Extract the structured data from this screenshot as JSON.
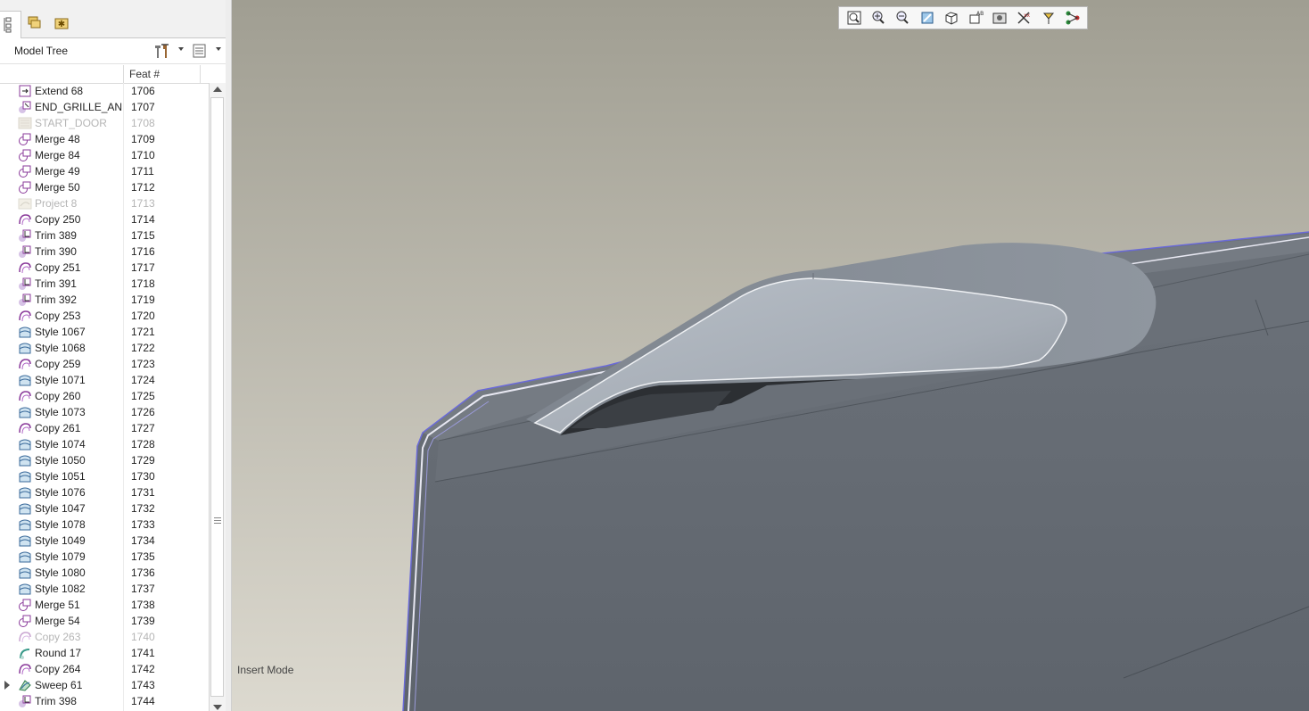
{
  "panel_tabs": [
    {
      "name": "model-tree-tab",
      "icon": "tree-icon",
      "active": true
    },
    {
      "name": "folder-browser-tab",
      "icon": "folders-icon",
      "active": false
    },
    {
      "name": "favorites-tab",
      "icon": "favorites-icon",
      "active": false
    }
  ],
  "model_tree": {
    "title": "Model Tree",
    "settings_icon": "tree-settings-icon",
    "columns_icon": "show-columns-icon",
    "column_feat": "Feat #"
  },
  "rows": [
    {
      "name": "Extend 68",
      "feat": "1706",
      "icon": "extend",
      "suppressed": false
    },
    {
      "name": "END_GRILLE_AN",
      "feat": "1707",
      "icon": "insert",
      "suppressed": false
    },
    {
      "name": "START_DOOR",
      "feat": "1708",
      "icon": "group",
      "suppressed": true
    },
    {
      "name": "Merge 48",
      "feat": "1709",
      "icon": "merge",
      "suppressed": false
    },
    {
      "name": "Merge 84",
      "feat": "1710",
      "icon": "merge",
      "suppressed": false
    },
    {
      "name": "Merge 49",
      "feat": "1711",
      "icon": "merge",
      "suppressed": false
    },
    {
      "name": "Merge 50",
      "feat": "1712",
      "icon": "merge",
      "suppressed": false
    },
    {
      "name": "Project 8",
      "feat": "1713",
      "icon": "project",
      "suppressed": true
    },
    {
      "name": "Copy 250",
      "feat": "1714",
      "icon": "copy",
      "suppressed": false
    },
    {
      "name": "Trim 389",
      "feat": "1715",
      "icon": "trim",
      "suppressed": false
    },
    {
      "name": "Trim 390",
      "feat": "1716",
      "icon": "trim",
      "suppressed": false
    },
    {
      "name": "Copy 251",
      "feat": "1717",
      "icon": "copy",
      "suppressed": false
    },
    {
      "name": "Trim 391",
      "feat": "1718",
      "icon": "trim",
      "suppressed": false
    },
    {
      "name": "Trim 392",
      "feat": "1719",
      "icon": "trim",
      "suppressed": false
    },
    {
      "name": "Copy 253",
      "feat": "1720",
      "icon": "copy",
      "suppressed": false
    },
    {
      "name": "Style 1067",
      "feat": "1721",
      "icon": "style",
      "suppressed": false
    },
    {
      "name": "Style 1068",
      "feat": "1722",
      "icon": "style",
      "suppressed": false
    },
    {
      "name": "Copy 259",
      "feat": "1723",
      "icon": "copy",
      "suppressed": false
    },
    {
      "name": "Style 1071",
      "feat": "1724",
      "icon": "style",
      "suppressed": false
    },
    {
      "name": "Copy 260",
      "feat": "1725",
      "icon": "copy",
      "suppressed": false
    },
    {
      "name": "Style 1073",
      "feat": "1726",
      "icon": "style",
      "suppressed": false
    },
    {
      "name": "Copy 261",
      "feat": "1727",
      "icon": "copy",
      "suppressed": false
    },
    {
      "name": "Style 1074",
      "feat": "1728",
      "icon": "style",
      "suppressed": false
    },
    {
      "name": "Style 1050",
      "feat": "1729",
      "icon": "style",
      "suppressed": false
    },
    {
      "name": "Style 1051",
      "feat": "1730",
      "icon": "style",
      "suppressed": false
    },
    {
      "name": "Style 1076",
      "feat": "1731",
      "icon": "style",
      "suppressed": false
    },
    {
      "name": "Style 1047",
      "feat": "1732",
      "icon": "style",
      "suppressed": false
    },
    {
      "name": "Style 1078",
      "feat": "1733",
      "icon": "style",
      "suppressed": false
    },
    {
      "name": "Style 1049",
      "feat": "1734",
      "icon": "style",
      "suppressed": false
    },
    {
      "name": "Style 1079",
      "feat": "1735",
      "icon": "style",
      "suppressed": false
    },
    {
      "name": "Style 1080",
      "feat": "1736",
      "icon": "style",
      "suppressed": false
    },
    {
      "name": "Style 1082",
      "feat": "1737",
      "icon": "style",
      "suppressed": false
    },
    {
      "name": "Merge 51",
      "feat": "1738",
      "icon": "merge",
      "suppressed": false
    },
    {
      "name": "Merge 54",
      "feat": "1739",
      "icon": "merge",
      "suppressed": false
    },
    {
      "name": "Copy 263",
      "feat": "1740",
      "icon": "copy",
      "suppressed": true
    },
    {
      "name": "Round 17",
      "feat": "1741",
      "icon": "round",
      "suppressed": false
    },
    {
      "name": "Copy 264",
      "feat": "1742",
      "icon": "copy",
      "suppressed": false
    },
    {
      "name": "Sweep 61",
      "feat": "1743",
      "icon": "sweep",
      "suppressed": false,
      "expandable": true
    },
    {
      "name": "Trim 398",
      "feat": "1744",
      "icon": "trim",
      "suppressed": false
    }
  ],
  "view_toolbar": [
    "refit-icon",
    "zoom-in-icon",
    "zoom-out-icon",
    "repaint-icon",
    "saved-orientations-icon",
    "view-manager-icon",
    "display-style-icon",
    "datum-display-icon",
    "annotation-display-icon",
    "spin-center-icon"
  ],
  "status": {
    "mode": "Insert Mode"
  },
  "colors": {
    "bg_top": "#a09e92",
    "bg_bottom": "#dcd9cf",
    "model_body": "#646a72",
    "model_light": "#aeb5bd",
    "edge_highlight": "#6a6ad8"
  }
}
